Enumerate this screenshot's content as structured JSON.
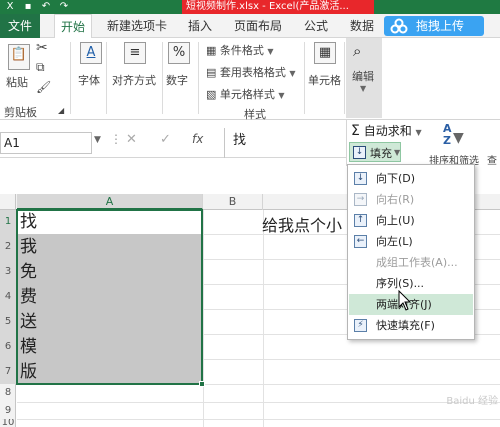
{
  "title_bar": {
    "title": "短视频制作.xlsx - Excel(产品激活..."
  },
  "tabs": {
    "file": "文件",
    "items": [
      "开始",
      "新建选项卡",
      "插入",
      "页面布局",
      "公式",
      "数据"
    ],
    "baidu_upload": "拖拽上传"
  },
  "ribbon": {
    "clipboard": {
      "paste": "粘贴",
      "group": "剪贴板"
    },
    "font": "字体",
    "alignment": "对齐方式",
    "number": "数字",
    "styles": {
      "conditional": "条件格式",
      "table": "套用表格格式",
      "cell": "单元格样式",
      "group": "样式"
    },
    "cells": "单元格",
    "editing": "编辑"
  },
  "formula_bar": {
    "name_box": "A1",
    "fx_symbol": "fx",
    "content": "找"
  },
  "edit_panel": {
    "autosum": "自动求和",
    "fill": "填充",
    "sort_filter": "排序和筛选",
    "find": "查"
  },
  "fill_menu": [
    {
      "label": "向下(D)",
      "icon": "arrow-down-icon",
      "enabled": true
    },
    {
      "label": "向右(R)",
      "icon": "arrow-right-icon",
      "enabled": false
    },
    {
      "label": "向上(U)",
      "icon": "arrow-up-icon",
      "enabled": true
    },
    {
      "label": "向左(L)",
      "icon": "arrow-left-icon",
      "enabled": true
    },
    {
      "label": "成组工作表(A)...",
      "icon": "",
      "enabled": false
    },
    {
      "label": "序列(S)...",
      "icon": "",
      "enabled": true
    },
    {
      "label": "两端对齐(J)",
      "icon": "",
      "enabled": true,
      "hover": true
    },
    {
      "label": "快速填充(F)",
      "icon": "flash-fill-icon",
      "enabled": true
    }
  ],
  "sheet": {
    "columns": [
      "A",
      "B"
    ],
    "rows": [
      "1",
      "2",
      "3",
      "4",
      "5",
      "6",
      "7",
      "8",
      "9",
      "10"
    ],
    "col_a": [
      "找",
      "我",
      "免",
      "费",
      "送",
      "模",
      "版"
    ],
    "b1": "给我点个小"
  },
  "watermark": "Baidu 经验",
  "colors": {
    "excel_green": "#217346",
    "title_red": "#e8272b",
    "baidu_blue": "#3aa3f2",
    "hover_green": "#cfe8d7",
    "selection_gray": "#c7c7c7"
  }
}
